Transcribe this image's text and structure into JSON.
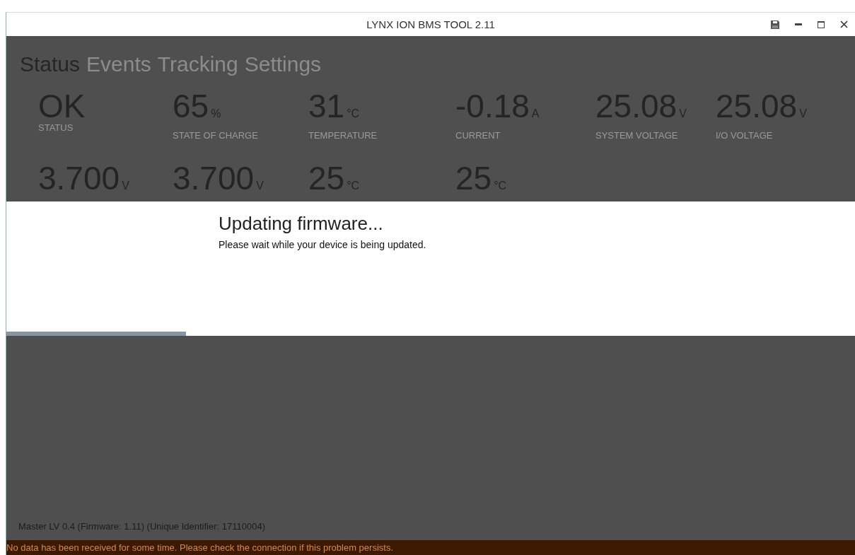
{
  "window": {
    "title": "LYNX ION BMS TOOL 2.11"
  },
  "tabs": [
    {
      "label": "Status",
      "selected": true
    },
    {
      "label": "Events",
      "selected": false
    },
    {
      "label": "Tracking",
      "selected": false
    },
    {
      "label": "Settings",
      "selected": false
    }
  ],
  "stats": [
    {
      "value": "OK",
      "label": "STATUS"
    },
    {
      "value": "65",
      "unit": "%",
      "label": "STATE OF CHARGE"
    },
    {
      "value": "31",
      "unit": "°C",
      "label": "TEMPERATURE"
    },
    {
      "value": "-0.18",
      "unit": "A",
      "label": "CURRENT"
    },
    {
      "value": "25.08",
      "unit": "V",
      "label": "SYSTEM VOLTAGE"
    },
    {
      "value": "25.08",
      "unit": "V",
      "label": "I/O VOLTAGE"
    }
  ],
  "stats_row_2": [
    {
      "value": "3.700",
      "unit": "V"
    },
    {
      "value": "3.700",
      "unit": "V"
    },
    {
      "value": "25",
      "unit": "°C"
    },
    {
      "value": "25",
      "unit": "°C"
    }
  ],
  "dialog": {
    "title": "Updating firmware...",
    "message": "Please wait while your device is being updated.",
    "progress": {
      "level": 0.212
    }
  },
  "footer": "Master LV 0.4 (Firmware: 1.11) (Unique Identifier: 17110004)",
  "status_bar": "No data has been received for some time. Please check the connection if this problem persists."
}
